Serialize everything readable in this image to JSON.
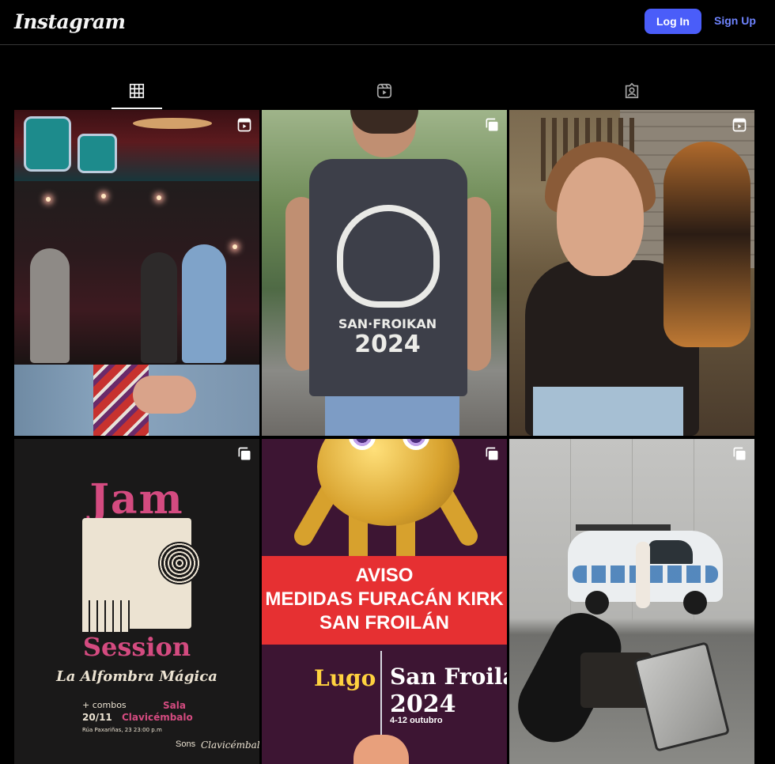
{
  "header": {
    "logo_text": "Instagram",
    "login_label": "Log In",
    "signup_label": "Sign Up"
  },
  "tabs": [
    {
      "name": "posts",
      "icon": "grid-icon",
      "active": true
    },
    {
      "name": "reels",
      "icon": "reels-icon",
      "active": false
    },
    {
      "name": "tagged",
      "icon": "tagged-icon",
      "active": false
    }
  ],
  "posts": [
    {
      "type": "reel",
      "badge_icon": "reels-icon"
    },
    {
      "type": "carousel",
      "badge_icon": "carousel-icon",
      "print": {
        "line1": "SAN·FROIKAN",
        "line2": "2024"
      }
    },
    {
      "type": "reel",
      "badge_icon": "reels-icon"
    },
    {
      "type": "carousel",
      "badge_icon": "carousel-icon",
      "poster": {
        "title": "Jam",
        "subtitle": "Session",
        "venue_name": "La Alfombra Mágica",
        "combos": "+ combos",
        "sala": "Sala",
        "date": "20/11",
        "place": "Clavicémbalo",
        "address": "Rúa Paxariñas, 23          23:00 p.m",
        "brand": "Sons",
        "signature": "Clavicémbalo"
      }
    },
    {
      "type": "carousel",
      "badge_icon": "carousel-icon",
      "poster": {
        "alert_line1": "AVISO",
        "alert_line2": "MEDIDAS FURACÁN KIRK",
        "alert_line3": "SAN FROILÁN",
        "city": "Lugo",
        "event": "San Froilán",
        "year": "2024",
        "dates": "4-12 outubro"
      }
    },
    {
      "type": "carousel",
      "badge_icon": "carousel-icon"
    }
  ],
  "colors": {
    "background": "#000000",
    "accent_button": "#4a5df9",
    "link": "#6f84ff",
    "divider": "#363636"
  }
}
